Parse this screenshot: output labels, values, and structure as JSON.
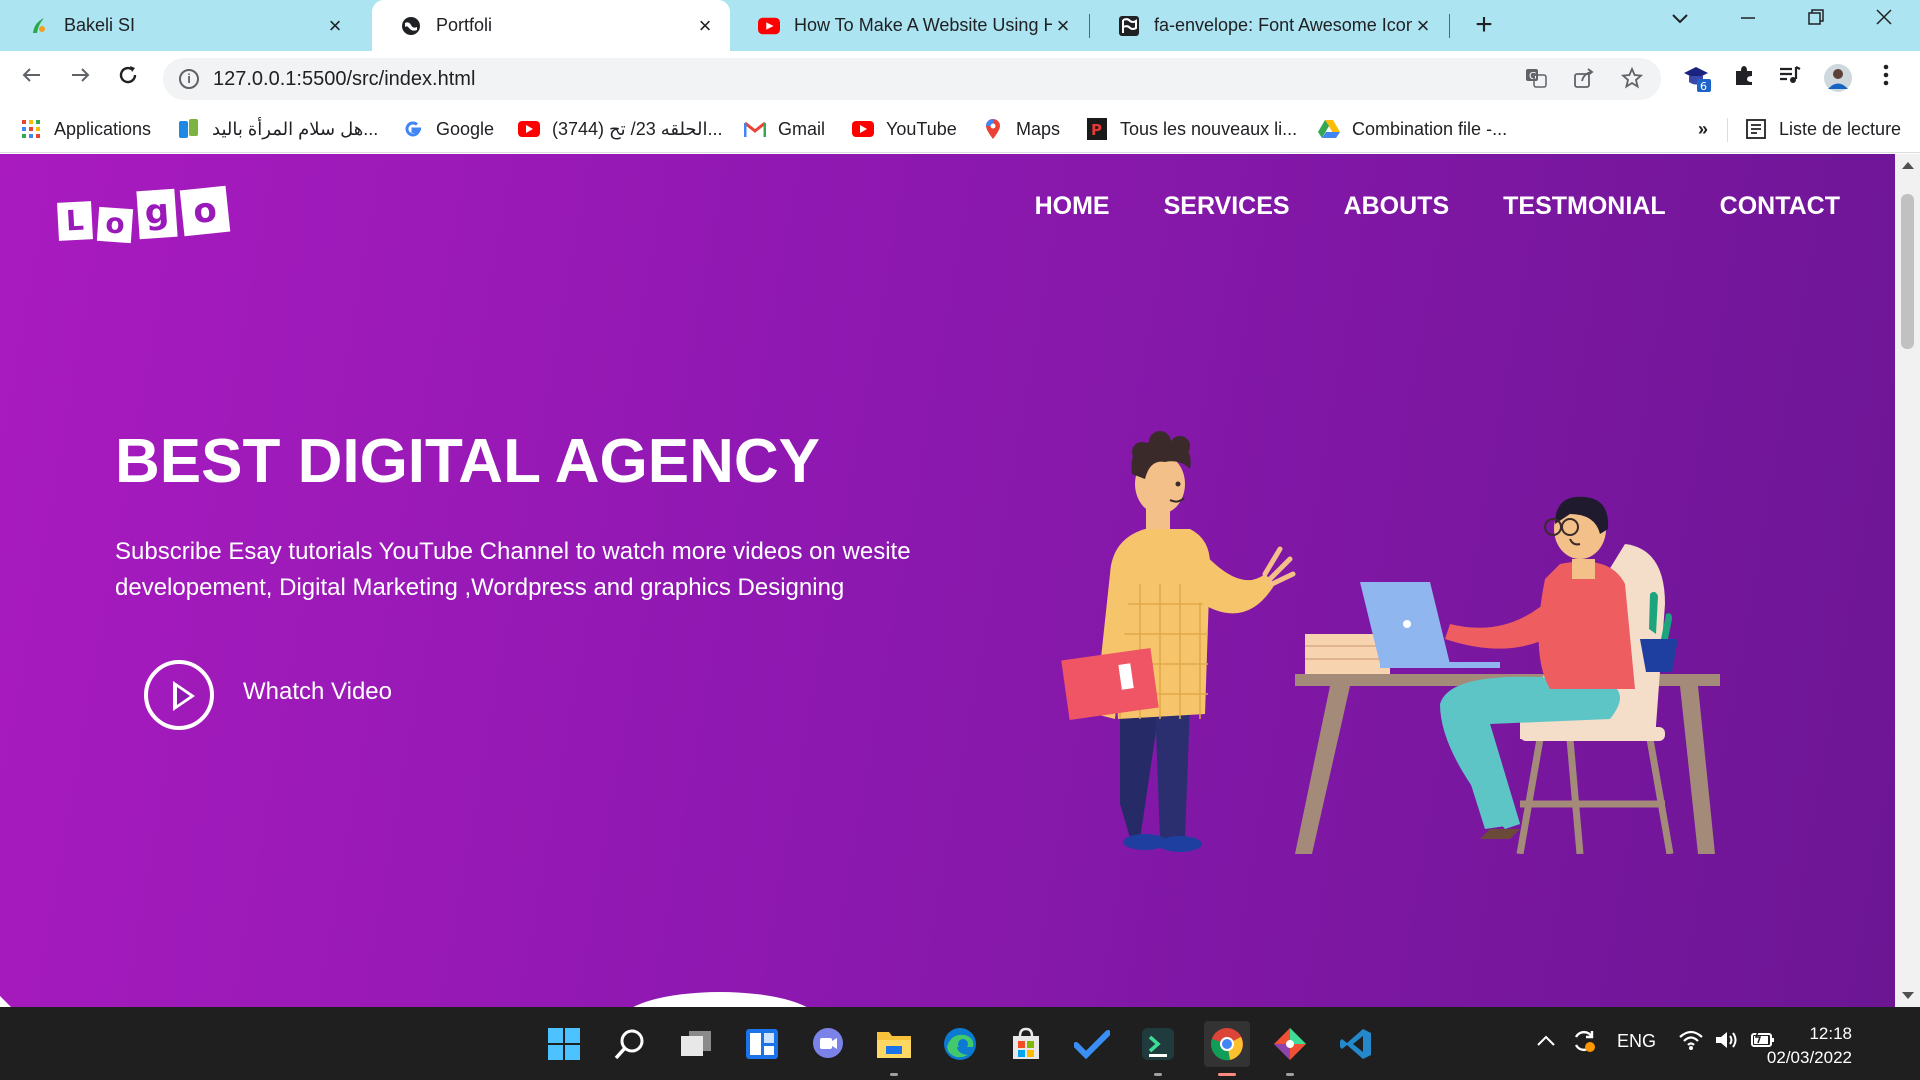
{
  "browser": {
    "tabs": [
      {
        "title": "Bakeli SI",
        "icon": "bakeli-icon",
        "active": false
      },
      {
        "title": "Portfoli",
        "icon": "globe-icon",
        "active": true
      },
      {
        "title": "How To Make A Website Using H",
        "icon": "youtube-icon",
        "active": false
      },
      {
        "title": "fa-envelope: Font Awesome Icon",
        "icon": "font-awesome-flag-icon",
        "active": false
      }
    ],
    "url": "127.0.0.1:5500/src/index.html",
    "bookmarks": [
      {
        "label": "Applications",
        "icon": "apps-grid-icon"
      },
      {
        "label": "هل سلام المرأة باليد...",
        "icon": "bookmark-app-icon"
      },
      {
        "label": "Google",
        "icon": "google-icon"
      },
      {
        "label": "(3744) الحلقه 23/ تح...",
        "icon": "youtube-icon"
      },
      {
        "label": "Gmail",
        "icon": "gmail-icon"
      },
      {
        "label": "YouTube",
        "icon": "youtube-icon"
      },
      {
        "label": "Maps",
        "icon": "maps-icon"
      },
      {
        "label": "Tous les nouveaux li...",
        "icon": "pdf-site-icon"
      },
      {
        "label": "Combination file -...",
        "icon": "google-drive-icon"
      }
    ],
    "overflow_label": "»",
    "reading_list": "Liste de lecture",
    "extension_badge": "6"
  },
  "site": {
    "logo_letters": [
      "L",
      "o",
      "g",
      "o"
    ],
    "nav": [
      "HOME",
      "SERVICES",
      "ABOUTS",
      "TESTMONIAL",
      "CONTACT"
    ],
    "hero_title": "BEST DIGITAL AGENCY",
    "hero_text": "Subscribe Esay tutorials YouTube Channel to watch more videos on wesite developement, Digital Marketing ,Wordpress and graphics Designing",
    "video_label": "Whatch Video"
  },
  "taskbar": {
    "language": "ENG",
    "time": "12:18",
    "date": "02/03/2022"
  },
  "colors": {
    "hero_gradient_start": "#a91bbf",
    "hero_gradient_end": "#6c1694",
    "tab_bar": "#ace4f1",
    "taskbar": "#1f1f1f"
  }
}
